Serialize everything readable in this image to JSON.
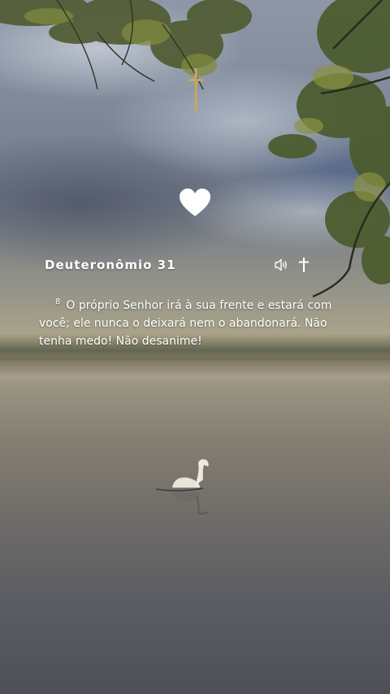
{
  "verse": {
    "reference": "Deuteronômio 31",
    "number": "8",
    "text": "O próprio Senhor irá à sua frente e estará com você; ele nunca o deixará nem o abandonará. Não tenha medo! Não desanime!"
  },
  "icons": {
    "top_ornament": "cross-icon",
    "favorite": "heart-icon",
    "audio": "speaker-icon",
    "cross": "cross-icon"
  },
  "colors": {
    "text": "#ffffff",
    "cross_gold": "#c9a85a"
  }
}
